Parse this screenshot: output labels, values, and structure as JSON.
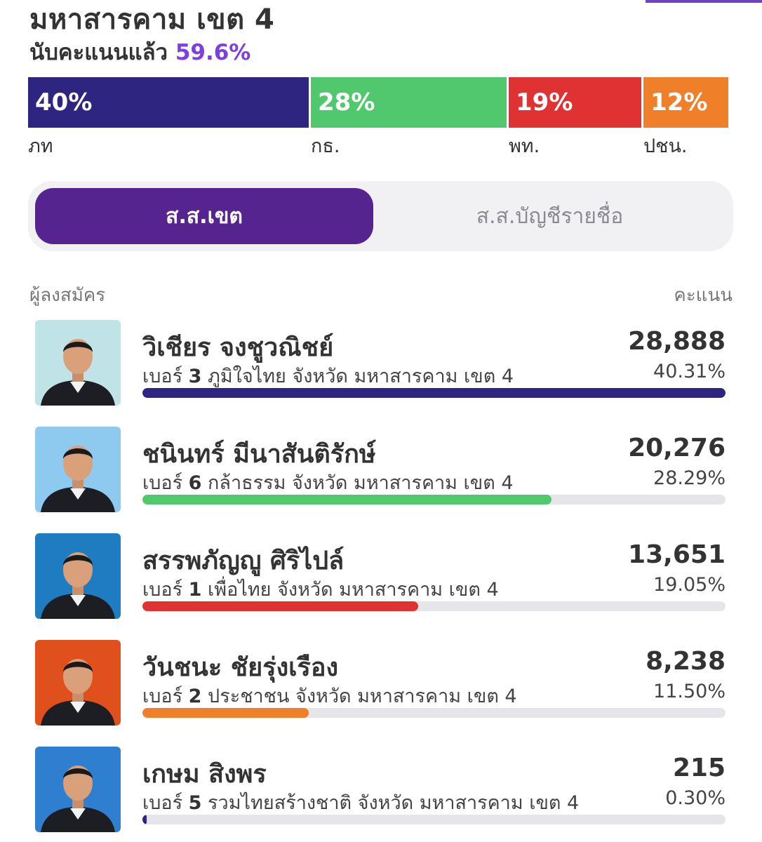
{
  "header": {
    "title": "มหาสารคาม เขต 4",
    "counted_label": "นับคะแนนแล้ว",
    "counted_percent": "59.6%"
  },
  "party_bar": [
    {
      "label": "40%",
      "party": "ภท",
      "share": 40,
      "color": "#2e2580"
    },
    {
      "label": "28%",
      "party": "กธ.",
      "share": 28,
      "color": "#52c86e"
    },
    {
      "label": "19%",
      "party": "พท.",
      "share": 19,
      "color": "#e03232"
    },
    {
      "label": "12%",
      "party": "ปชน.",
      "share": 12,
      "color": "#f07f29"
    }
  ],
  "tabs": {
    "active": "ส.ส.เขต",
    "inactive": "ส.ส.บัญชีรายชื่อ"
  },
  "list_header": {
    "left": "ผู้ลงสมัคร",
    "right": "คะแนน"
  },
  "candidates": [
    {
      "name": "วิเชียร จงชูวณิชย์",
      "number_label": "เบอร์",
      "number": "3",
      "detail": "ภูมิใจไทย จังหวัด มหาสารคาม เขต 4",
      "votes": "28,888",
      "share_text": "40.31%",
      "share": 40.31,
      "color": "#2e2580",
      "photo_bg": "#bfe3e6",
      "photo_icon": "candidate-photo"
    },
    {
      "name": "ชนินทร์ มีนาสันติรักษ์",
      "number_label": "เบอร์",
      "number": "6",
      "detail": "กล้าธรรม จังหวัด มหาสารคาม เขต 4",
      "votes": "20,276",
      "share_text": "28.29%",
      "share": 28.29,
      "color": "#52c86e",
      "photo_bg": "#8ec9ef",
      "photo_icon": "candidate-photo"
    },
    {
      "name": "สรรพภัญญู ศิริไปล์",
      "number_label": "เบอร์",
      "number": "1",
      "detail": "เพื่อไทย จังหวัด มหาสารคาม เขต 4",
      "votes": "13,651",
      "share_text": "19.05%",
      "share": 19.05,
      "color": "#e03232",
      "photo_bg": "#1f7cc0",
      "photo_icon": "candidate-photo"
    },
    {
      "name": "วันชนะ ชัยรุ่งเรือง",
      "number_label": "เบอร์",
      "number": "2",
      "detail": "ประชาชน จังหวัด มหาสารคาม เขต 4",
      "votes": "8,238",
      "share_text": "11.50%",
      "share": 11.5,
      "color": "#f07f29",
      "photo_bg": "#e0501c",
      "photo_icon": "candidate-photo"
    },
    {
      "name": "เกษม สิงพร",
      "number_label": "เบอร์",
      "number": "5",
      "detail": "รวมไทยสร้างชาติ จังหวัด มหาสารคาม เขต 4",
      "votes": "215",
      "share_text": "0.30%",
      "share": 0.3,
      "color": "#2e2580",
      "photo_bg": "#2f7fd0",
      "photo_icon": "candidate-photo"
    }
  ]
}
